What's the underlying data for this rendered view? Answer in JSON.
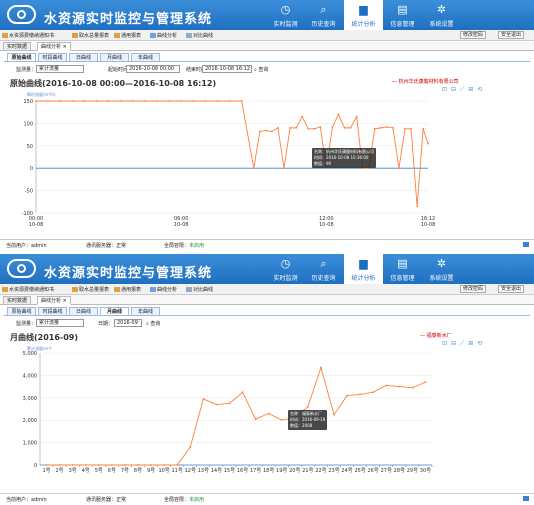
{
  "app": {
    "title": "水资源实时监控与管理系统",
    "nav": [
      {
        "label": "实时监测",
        "icon": "clock-icon"
      },
      {
        "label": "历史查询",
        "icon": "search-icon"
      },
      {
        "label": "统计分析",
        "icon": "bar-chart-icon",
        "active": true
      },
      {
        "label": "信息管理",
        "icon": "document-icon"
      },
      {
        "label": "系统设置",
        "icon": "gear-icon"
      }
    ],
    "menu": [
      "水资源费缴纳通知书",
      "取水总量报表",
      "通用报表",
      "曲线分析",
      "对比曲线"
    ],
    "change_password": "修改密码",
    "logout": "安全退出",
    "tabs": [
      "实时数据",
      "曲线分析"
    ],
    "tab_close": "×",
    "subtabs": [
      "原始曲线",
      "时段曲线",
      "日曲线",
      "月曲线",
      "年曲线"
    ],
    "footer": {
      "user_label": "当前用户：",
      "user": "admin",
      "service_label": "通讯服务器：",
      "service_status": "正常",
      "db_label": "全局容限：",
      "db_status": "未启用"
    }
  },
  "top": {
    "form": {
      "type_label": "监测量：",
      "type_value": "累计流量",
      "start_label": "起始时间：",
      "start_value": "2016-10-08 00:00",
      "end_label": "结束时间：",
      "end_value": "2016-10-08 16:12",
      "query": "查询"
    },
    "chart_title": "原始曲线(2016-10-08 00:00—2016-10-08 16:12)",
    "legend": "杭州华氏康酸材料有限公司",
    "unit": "瞬时流量(m³/h)",
    "tooltip": [
      "名称：杭州华氏康酸材料有限公司",
      "时间：2016-10-08 10:36:00",
      "数值：90"
    ],
    "chart_data": {
      "type": "line",
      "ylim": [
        -100,
        150
      ],
      "yticks": [
        150,
        100,
        50,
        0,
        -50,
        -100
      ],
      "xticks": [
        "00:00 10-08",
        "06:00 10-08",
        "12:00 10-08",
        "16:12 10-08"
      ],
      "series": [
        {
          "name": "杭州华氏康酸材料有限公司",
          "color": "#ff7f3f",
          "x": [
            0,
            0.5,
            1,
            1.5,
            2,
            2.5,
            3,
            3.5,
            4,
            4.5,
            5,
            5.5,
            6,
            6.5,
            7,
            7.5,
            8,
            8.5,
            9,
            9.25,
            9.5,
            9.75,
            10,
            10.25,
            10.5,
            10.75,
            11,
            11.25,
            11.5,
            11.75,
            12,
            12.25,
            12.5,
            12.75,
            13,
            13.25,
            13.5,
            13.75,
            14,
            14.25,
            14.5,
            14.75,
            15,
            15.25,
            15.5,
            15.75,
            16,
            16.2
          ],
          "y": [
            150,
            150,
            150,
            150,
            150,
            150,
            150,
            150,
            150,
            150,
            150,
            150,
            150,
            150,
            150,
            150,
            150,
            150,
            0,
            82,
            84,
            82,
            90,
            0,
            90,
            90,
            115,
            88,
            88,
            92,
            0,
            92,
            120,
            90,
            90,
            115,
            0,
            0,
            88,
            90,
            92,
            90,
            0,
            88,
            88,
            -85,
            88,
            55
          ]
        }
      ]
    }
  },
  "bottom": {
    "form": {
      "type_label": "监测量：",
      "type_value": "累计流量",
      "day_label": "日期：",
      "day_value": "2016-09",
      "query": "查询"
    },
    "chart_title": "月曲线(2016-09)",
    "legend": "福泰新水厂",
    "unit": "累计流量(m³)",
    "tooltip": [
      "名称：福泰新水厂",
      "时间：2016-09-19",
      "数值：2008"
    ],
    "chart_data": {
      "type": "line",
      "ylim": [
        0,
        5000
      ],
      "yticks": [
        5000,
        4000,
        3000,
        2000,
        1000,
        0
      ],
      "categories": [
        "1号",
        "2号",
        "3号",
        "4号",
        "5号",
        "6号",
        "7号",
        "8号",
        "9号",
        "10号",
        "11号",
        "12号",
        "13号",
        "14号",
        "15号",
        "16号",
        "17号",
        "18号",
        "19号",
        "20号",
        "21号",
        "22号",
        "23号",
        "24号",
        "25号",
        "26号",
        "27号",
        "28号",
        "29号",
        "30号"
      ],
      "series": [
        {
          "name": "福泰新水厂",
          "color": "#ff7f3f",
          "values": [
            0,
            0,
            0,
            0,
            0,
            0,
            0,
            0,
            0,
            0,
            0,
            800,
            2950,
            2700,
            2750,
            3250,
            2050,
            2300,
            2008,
            2100,
            2600,
            4350,
            2250,
            3100,
            3150,
            3250,
            3550,
            3500,
            3450,
            3700
          ]
        }
      ]
    }
  }
}
